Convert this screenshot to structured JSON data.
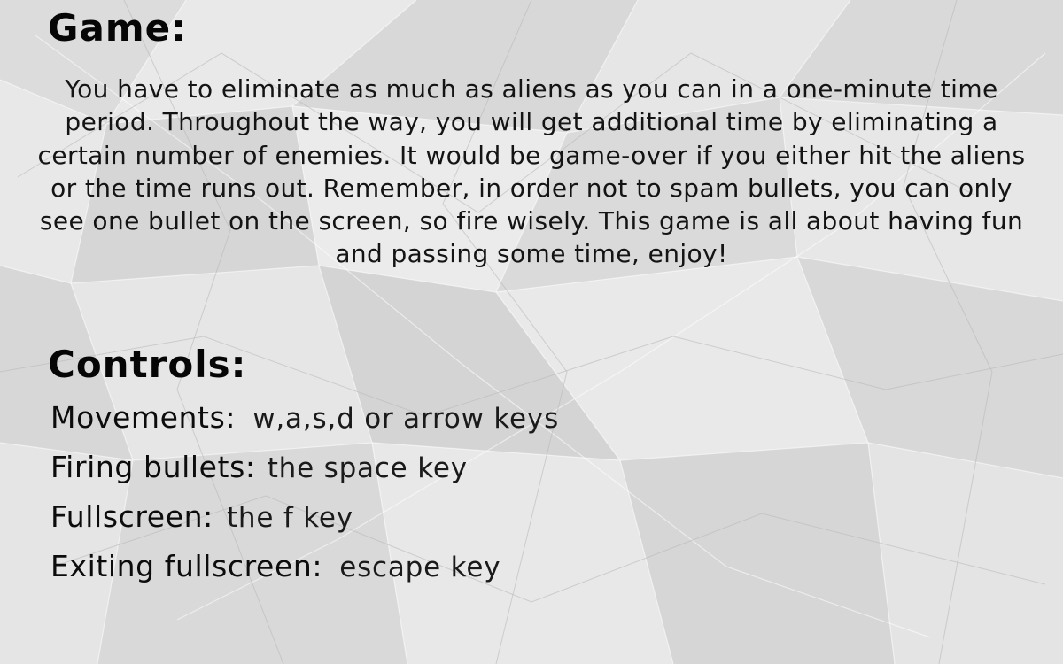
{
  "colors": {
    "paper": "#e4e4e4",
    "text": "#0c0c0c"
  },
  "game": {
    "heading": "Game:",
    "description": "You have to eliminate as much as aliens as you can in a one-minute time period. Throughout the way, you will get additional time by eliminating a certain number of enemies. It would be game-over if you either hit the aliens or the time runs out. Remember, in order not to spam bullets, you can only see one bullet on the screen, so fire wisely. This game is all about having fun and passing some time, enjoy!"
  },
  "controls": {
    "heading": "Controls:",
    "items": [
      {
        "label": "Movements:",
        "value": "w,a,s,d or arrow keys"
      },
      {
        "label": "Firing bullets:",
        "value": "the space key"
      },
      {
        "label": "Fullscreen:",
        "value": "the f key"
      },
      {
        "label": "Exiting fullscreen:",
        "value": "escape key"
      }
    ]
  }
}
